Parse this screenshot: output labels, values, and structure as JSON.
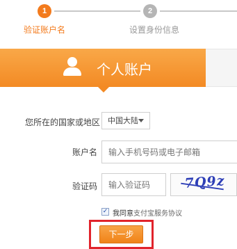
{
  "steps": [
    {
      "number": "1",
      "label": "验证账户名",
      "state": "active"
    },
    {
      "number": "2",
      "label": "设置身份信息",
      "state": "inactive"
    }
  ],
  "banner": {
    "icon": "user-icon",
    "title": "个人账户"
  },
  "form": {
    "country": {
      "label": "您所在的国家或地区",
      "selected": "中国大陆"
    },
    "account": {
      "label": "账户名",
      "placeholder": "输入手机号码或电子邮箱"
    },
    "captcha": {
      "label": "验证码",
      "placeholder": "输入验证码",
      "image_text": "7Q9z"
    },
    "agreement": {
      "checked": true,
      "prefix": "我同意",
      "link": "支付宝服务协议"
    },
    "next_button": "下一步"
  },
  "colors": {
    "accent": "#f37b1d",
    "inactive_step": "#b5b5b5",
    "highlight": "#e1232b",
    "captcha_text": "#2e3fb7"
  }
}
